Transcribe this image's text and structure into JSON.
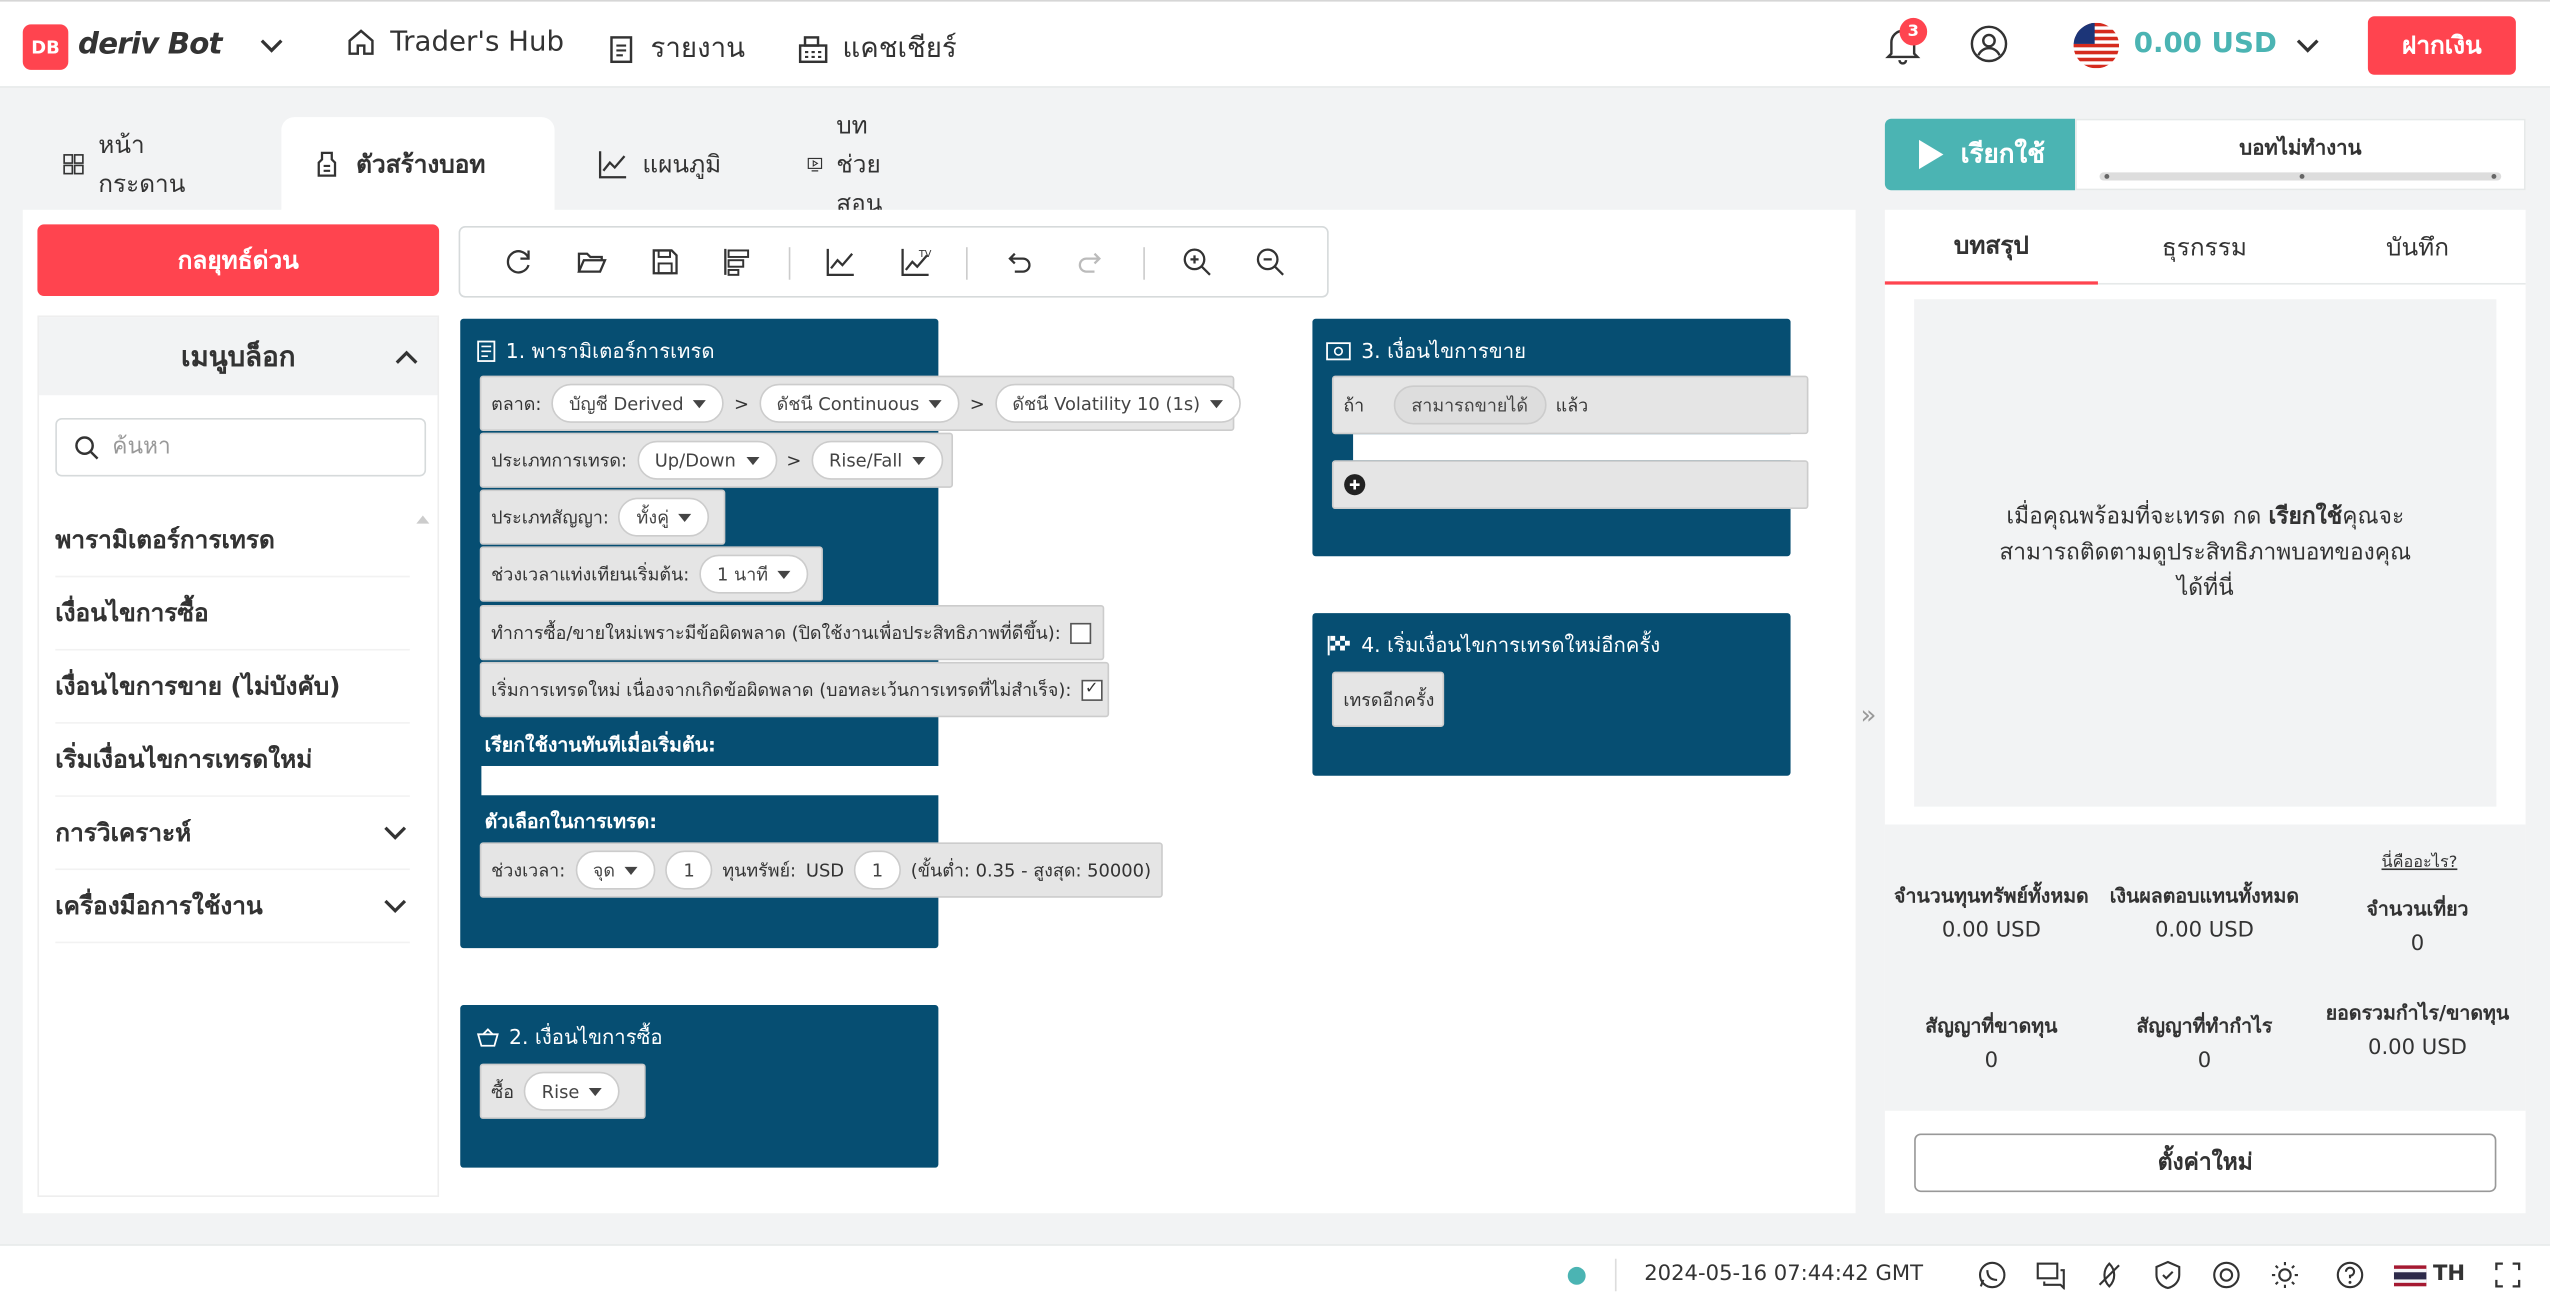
{
  "header": {
    "logo_badge": "DB",
    "logo_text": "deriv Bot",
    "nav": [
      {
        "label": "Trader's Hub",
        "icon": "home-icon"
      },
      {
        "label": "รายงาน",
        "icon": "report-icon"
      },
      {
        "label": "แคชเชียร์",
        "icon": "cashier-icon"
      }
    ],
    "notification_count": "3",
    "balance": "0.00 USD",
    "deposit_label": "ฝากเงิน"
  },
  "tabs": [
    {
      "label": "หน้ากระดาน",
      "icon": "dashboard-icon",
      "active": false
    },
    {
      "label": "ตัวสร้างบอท",
      "icon": "bot-builder-icon",
      "active": true
    },
    {
      "label": "แผนภูมิ",
      "icon": "chart-icon",
      "active": false
    },
    {
      "label": "บทช่วยสอน",
      "icon": "tutorial-icon",
      "active": false
    }
  ],
  "sidebar": {
    "quick_strategy": "กลยุทธ์ด่วน",
    "menu_title": "เมนูบล็อก",
    "search_placeholder": "ค้นหา",
    "items": [
      {
        "label": "พารามิเตอร์การเทรด",
        "expandable": false
      },
      {
        "label": "เงื่อนไขการซื้อ",
        "expandable": false
      },
      {
        "label": "เงื่อนไขการขาย (ไม่บังคับ)",
        "expandable": false
      },
      {
        "label": "เริ่มเงื่อนไขการเทรดใหม่",
        "expandable": false
      },
      {
        "label": "การวิเคราะห์",
        "expandable": true
      },
      {
        "label": "เครื่องมือการใช้งาน",
        "expandable": true
      }
    ]
  },
  "toolbar": [
    "reset-icon",
    "open-icon",
    "save-icon",
    "sort-icon",
    "chart-icon",
    "indicator-icon",
    "undo-icon",
    "redo-icon",
    "zoom-in-icon",
    "zoom-out-icon"
  ],
  "blocks": {
    "trade_params": {
      "title": "1. พารามิเตอร์การเทรด",
      "market_label": "ตลาด:",
      "market": "บัญชี Derived",
      "submarket": "ดัชนี Continuous",
      "symbol": "ดัชนี Volatility 10 (1s)",
      "trade_type_label": "ประเภทการเทรด:",
      "trade_type": "Up/Down",
      "trade_subtype": "Rise/Fall",
      "contract_type_label": "ประเภทสัญญา:",
      "contract_type": "ทั้งคู่",
      "candle_label": "ช่วงเวลาแท่งเทียนเริ่มต้น:",
      "candle": "1 นาที",
      "restart_buy_sell_label": "ทำการซื้อ/ขายใหม่เพราะมีข้อผิดพลาด (ปิดใช้งานเพื่อประสิทธิภาพที่ดีขึ้น):",
      "restart_buy_sell_checked": false,
      "restart_error_label": "เริ่มการเทรดใหม่ เนื่องจากเกิดข้อผิดพลาด (บอทละเว้นการเทรดที่ไม่สำเร็จ):",
      "restart_error_checked": true,
      "run_once_label": "เรียกใช้งานทันทีเมื่อเริ่มต้น:",
      "trade_options_label": "ตัวเลือกในการเทรด:",
      "duration_label": "ช่วงเวลา:",
      "duration_unit": "จุด",
      "duration_value": "1",
      "stake_label": "ทุนทรัพย์:",
      "currency": "USD",
      "stake_value": "1",
      "stake_limits": "(ขั้นต่ำ: 0.35 - สูงสุด: 50000)"
    },
    "purchase": {
      "title": "2. เงื่อนไขการซื้อ",
      "buy_label": "ซื้อ",
      "contract": "Rise"
    },
    "sell": {
      "title": "3. เงื่อนไขการขาย",
      "if_label": "ถ้า",
      "condition": "สามารถขายได้",
      "then_label": "แล้ว"
    },
    "restart": {
      "title": "4. เริ่มเงื่อนไขการเทรดใหม่อีกครั้ง",
      "trade_again": "เทรดอีกครั้ง"
    }
  },
  "run_panel": {
    "run_label": "เรียกใช้",
    "status": "บอทไม่ทำงาน",
    "tabs": [
      "บทสรุป",
      "ธุรกรรม",
      "บันทึก"
    ],
    "info_pre": "เมื่อคุณพร้อมที่จะเทรด กด ",
    "info_bold": "เรียกใช้",
    "info_post": "คุณจะสามารถติดตามดูประสิทธิภาพบอทของคุณได้ที่นี่",
    "what_is_this": "นี่คืออะไร?",
    "stats": [
      {
        "label": "จำนวนทุนทรัพย์ทั้งหมด",
        "value": "0.00 USD"
      },
      {
        "label": "เงินผลตอบแทนทั้งหมด",
        "value": "0.00 USD"
      },
      {
        "label": "จำนวนเที่ยว",
        "value": "0"
      },
      {
        "label": "สัญญาที่ขาดทุน",
        "value": "0"
      },
      {
        "label": "สัญญาที่ทำกำไร",
        "value": "0"
      },
      {
        "label": "ยอดรวมกำไร/ขาดทุน",
        "value": "0.00 USD"
      }
    ],
    "reset_label": "ตั้งค่าใหม่"
  },
  "footer": {
    "timestamp": "2024-05-16 07:44:42 GMT",
    "language": "TH"
  },
  "colors": {
    "brand_red": "#ff444f",
    "teal": "#4bb4b3",
    "block_blue": "#064e72"
  }
}
